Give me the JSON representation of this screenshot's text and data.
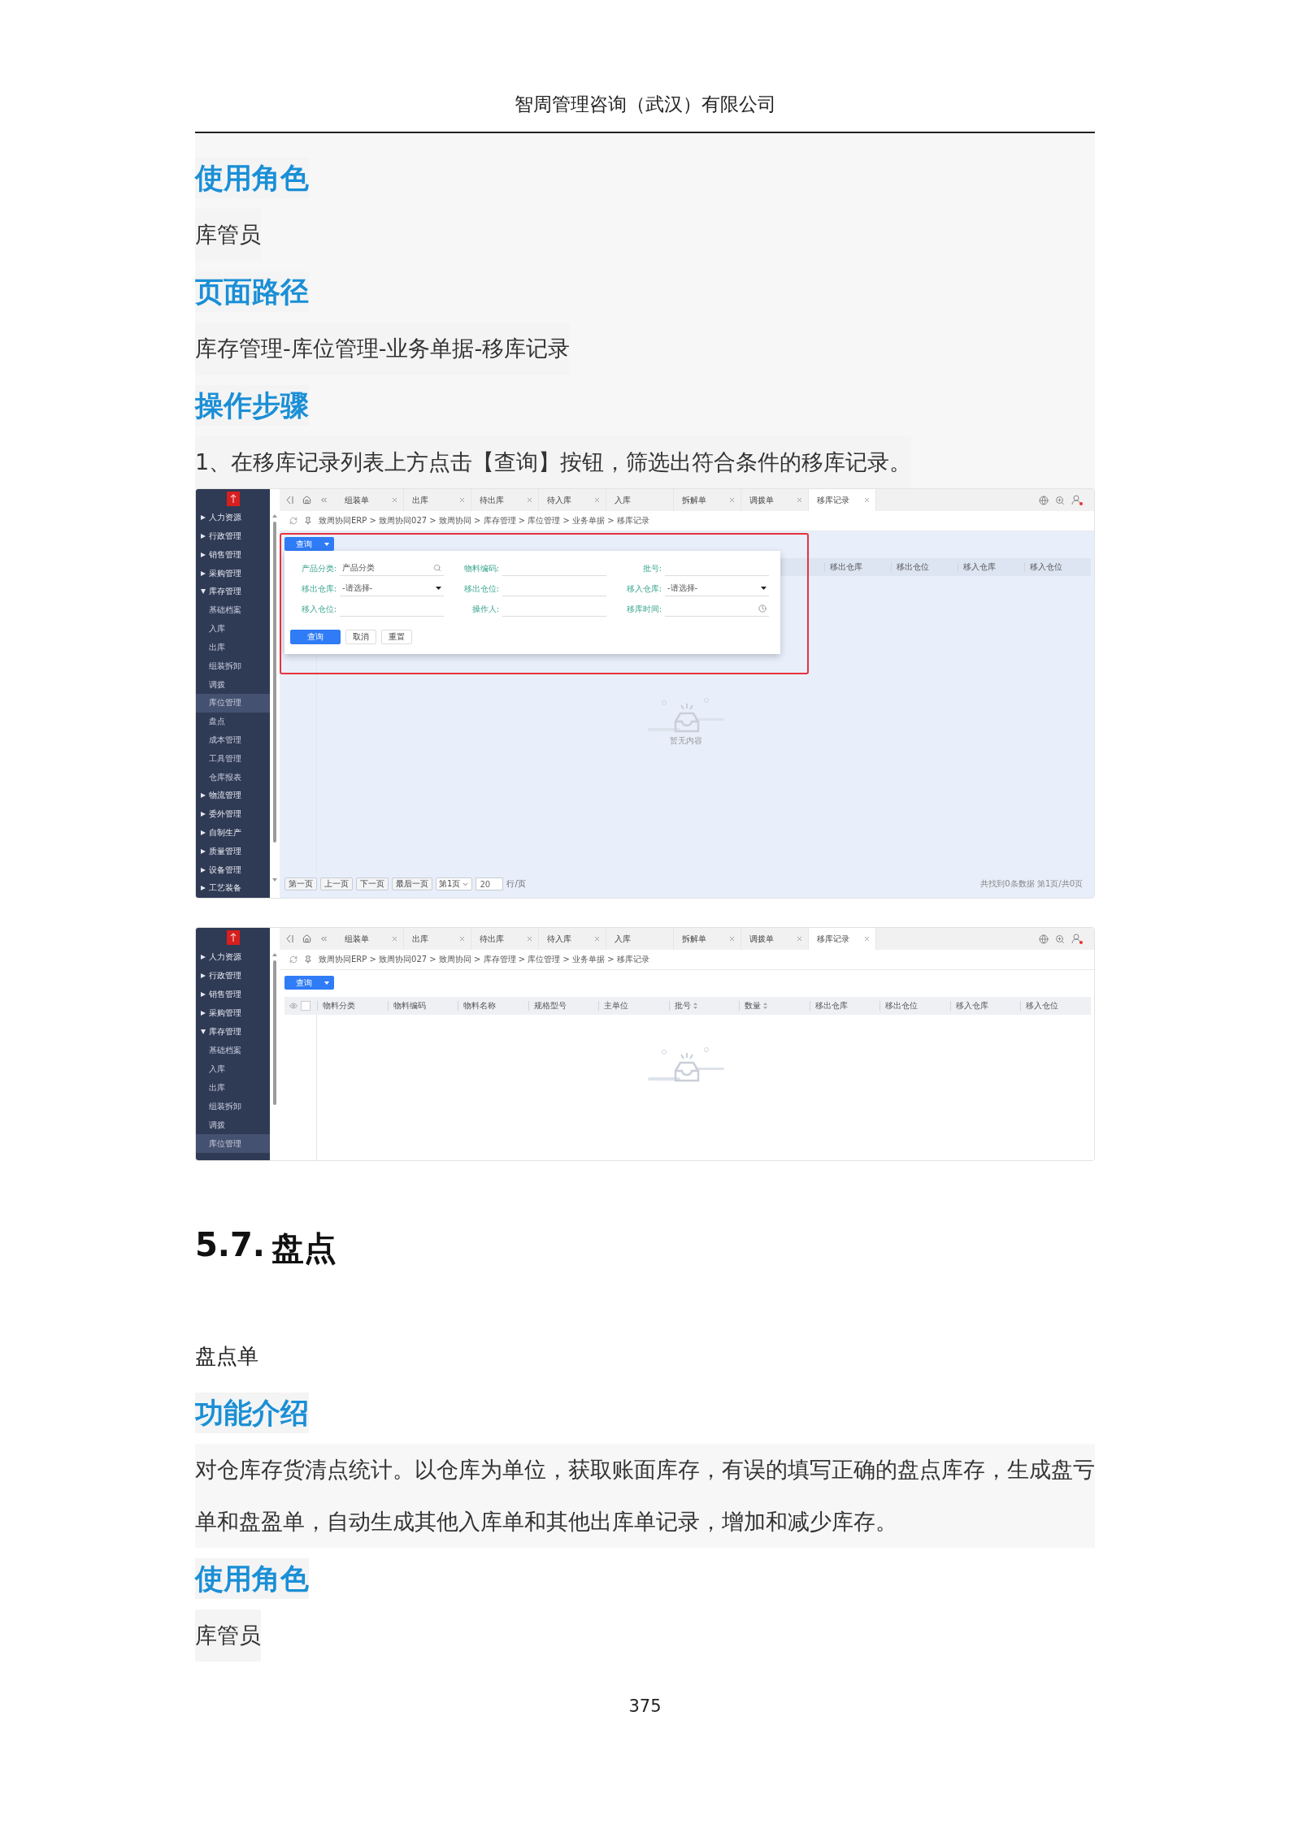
{
  "page_header": {
    "company": "智周管理咨询（武汉）有限公司"
  },
  "top_blocks": [
    {
      "kind": "heading",
      "text": "使用角色"
    },
    {
      "kind": "text",
      "text": "库管员"
    },
    {
      "kind": "heading",
      "text": "页面路径"
    },
    {
      "kind": "text",
      "text": "库存管理-库位管理-业务单据-移库记录"
    },
    {
      "kind": "heading",
      "text": "操作步骤"
    },
    {
      "kind": "text",
      "text": "1、在移库记录列表上方点击【查询】按钮，筛选出符合条件的移库记录。"
    }
  ],
  "screenshots": [
    {
      "kind": "popup_query",
      "sidebar": [
        {
          "label": "人力资源",
          "expanded": false
        },
        {
          "label": "行政管理",
          "expanded": false
        },
        {
          "label": "销售管理",
          "expanded": false
        },
        {
          "label": "采购管理",
          "expanded": false
        },
        {
          "label": "库存管理",
          "expanded": true,
          "children": [
            {
              "label": "基础档案",
              "selected": false
            },
            {
              "label": "入库",
              "selected": false
            },
            {
              "label": "出库",
              "selected": false
            },
            {
              "label": "组装拆卸",
              "selected": false
            },
            {
              "label": "调拨",
              "selected": false
            },
            {
              "label": "库位管理",
              "selected": true
            },
            {
              "label": "盘点",
              "selected": false
            },
            {
              "label": "成本管理",
              "selected": false
            },
            {
              "label": "工具管理",
              "selected": false
            },
            {
              "label": "仓库报表",
              "selected": false
            }
          ]
        },
        {
          "label": "物流管理",
          "expanded": false
        },
        {
          "label": "委外管理",
          "expanded": false
        },
        {
          "label": "自制生产",
          "expanded": false
        },
        {
          "label": "质量管理",
          "expanded": false
        },
        {
          "label": "设备管理",
          "expanded": false
        },
        {
          "label": "工艺装备",
          "expanded": false
        }
      ],
      "tabs": [
        {
          "label": "组装单",
          "selected": false
        },
        {
          "label": "出库",
          "selected": false
        },
        {
          "label": "待出库",
          "selected": false
        },
        {
          "label": "待入库",
          "selected": false
        },
        {
          "label": "入库",
          "selected": false
        },
        {
          "label": "拆解单",
          "selected": false
        },
        {
          "label": "调拨单",
          "selected": false
        },
        {
          "label": "移库记录",
          "selected": true
        }
      ],
      "breadcrumb": "致周协同ERP > 致周协同027 > 致周协同 > 库存管理 > 库位管理 > 业务单据 > 移库记录",
      "query_button": "查询",
      "columns": [
        {
          "label": "移出仓库",
          "sortable": false
        },
        {
          "label": "移出仓位",
          "sortable": false
        },
        {
          "label": "移入仓库",
          "sortable": false
        },
        {
          "label": "移入仓位",
          "sortable": false
        }
      ],
      "popup": {
        "highlighted": true,
        "fields": [
          {
            "label": "产品分类:",
            "kind": "picker",
            "value": "产品分类"
          },
          {
            "label": "物料编码:",
            "kind": "text"
          },
          {
            "label": "批号:",
            "kind": "text"
          },
          {
            "label": "移出仓库:",
            "kind": "select",
            "value": "-请选择-"
          },
          {
            "label": "移出仓位:",
            "kind": "text"
          },
          {
            "label": "移入仓库:",
            "kind": "select",
            "value": "-请选择-"
          },
          {
            "label": "移入仓位:",
            "kind": "text"
          },
          {
            "label": "操作人:",
            "kind": "text"
          },
          {
            "label": "移库时间:",
            "kind": "date"
          }
        ],
        "buttons": [
          {
            "label": "查询",
            "kind": "primary"
          },
          {
            "label": "取消",
            "kind": "default"
          },
          {
            "label": "重置",
            "kind": "default"
          }
        ]
      },
      "empty_text": "暂无内容",
      "pager": {
        "buttons": [
          "第一页",
          "上一页",
          "下一页",
          "最后一页"
        ],
        "page": "第1页",
        "page_size": "20",
        "unit": "行/页",
        "summary": "共找到0条数据 第1页/共0页"
      }
    },
    {
      "kind": "table_view",
      "sidebar": [
        {
          "label": "人力资源",
          "expanded": false
        },
        {
          "label": "行政管理",
          "expanded": false
        },
        {
          "label": "销售管理",
          "expanded": false
        },
        {
          "label": "采购管理",
          "expanded": false
        },
        {
          "label": "库存管理",
          "expanded": true,
          "children": [
            {
              "label": "基础档案",
              "selected": false
            },
            {
              "label": "入库",
              "selected": false
            },
            {
              "label": "出库",
              "selected": false
            },
            {
              "label": "组装拆卸",
              "selected": false
            },
            {
              "label": "调拨",
              "selected": false
            },
            {
              "label": "库位管理",
              "selected": true
            }
          ]
        }
      ],
      "tabs": [
        {
          "label": "组装单",
          "selected": false
        },
        {
          "label": "出库",
          "selected": false
        },
        {
          "label": "待出库",
          "selected": false
        },
        {
          "label": "待入库",
          "selected": false
        },
        {
          "label": "入库",
          "selected": false
        },
        {
          "label": "拆解单",
          "selected": false
        },
        {
          "label": "调拨单",
          "selected": false
        },
        {
          "label": "移库记录",
          "selected": true
        }
      ],
      "breadcrumb": "致周协同ERP > 致周协同027 > 致周协同 > 库存管理 > 库位管理 > 业务单据 > 移库记录",
      "query_button": "查询",
      "select_all": {
        "checked": false
      },
      "columns": [
        {
          "label": "物料分类",
          "sortable": false
        },
        {
          "label": "物料编码",
          "sortable": false
        },
        {
          "label": "物料名称",
          "sortable": false
        },
        {
          "label": "规格型号",
          "sortable": false
        },
        {
          "label": "主单位",
          "sortable": false
        },
        {
          "label": "批号",
          "sortable": true
        },
        {
          "label": "数量",
          "sortable": true
        },
        {
          "label": "移出仓库",
          "sortable": false
        },
        {
          "label": "移出仓位",
          "sortable": false
        },
        {
          "label": "移入仓库",
          "sortable": false
        },
        {
          "label": "移入仓位",
          "sortable": false
        }
      ]
    }
  ],
  "chapter": {
    "number": "5.7.",
    "title": "盘点"
  },
  "chapter_blocks": [
    {
      "kind": "plain",
      "text": "盘点单"
    },
    {
      "kind": "heading",
      "text": "功能介绍"
    },
    {
      "kind": "text",
      "text": "对仓库存货清点统计。以仓库为单位，获取账面库存，有误的填写正确的盘点库存，生成盘亏单和盘盈单，自动生成其他入库单和其他出库单记录，增加和减少库存。"
    },
    {
      "kind": "heading",
      "text": "使用角色"
    },
    {
      "kind": "text",
      "text": "库管员"
    }
  ],
  "page_number": "375"
}
